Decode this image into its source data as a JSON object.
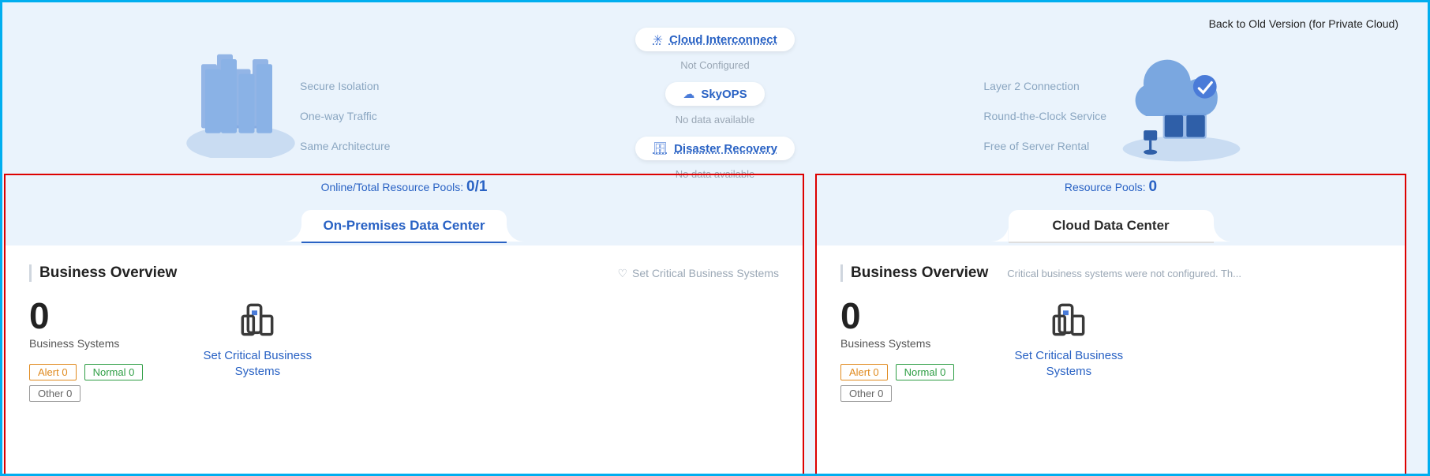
{
  "back_link": "Back to Old Version (for Private Cloud)",
  "left_features": [
    "Secure Isolation",
    "One-way Traffic",
    "Same Architecture"
  ],
  "right_features": [
    "Layer 2 Connection",
    "Round-the-Clock Service",
    "Free of Server Rental"
  ],
  "center": {
    "interconnect": {
      "title": "Cloud Interconnect",
      "sub": "Not Configured"
    },
    "skyops": {
      "title": "SkyOPS",
      "sub": "No data available"
    },
    "dr": {
      "title": "Disaster Recovery",
      "sub": "No data available"
    }
  },
  "left_dash": {
    "pool_label": "Online/Total Resource Pools:",
    "pool_value": "0/1",
    "tab": "On-Premises Data Center",
    "overview": "Business Overview",
    "set_link": "Set Critical Business Systems",
    "count": "0",
    "count_label": "Business Systems",
    "alert": "Alert 0",
    "normal": "Normal 0",
    "other": "Other 0",
    "card_link": "Set Critical Business Systems"
  },
  "right_dash": {
    "pool_label": "Resource Pools:",
    "pool_value": "0",
    "tab": "Cloud Data Center",
    "overview": "Business Overview",
    "side_note": "Critical business systems were not configured. Th...",
    "count": "0",
    "count_label": "Business Systems",
    "alert": "Alert 0",
    "normal": "Normal 0",
    "other": "Other 0",
    "card_link": "Set Critical Business Systems"
  }
}
